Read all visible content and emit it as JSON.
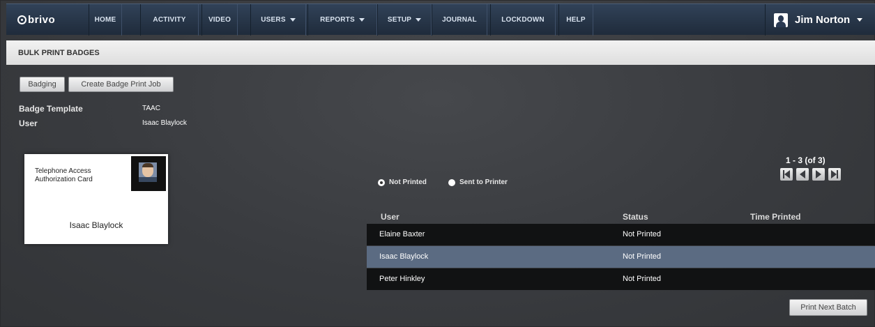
{
  "app": {
    "logo_text": "brivo"
  },
  "nav": {
    "home": "HOME",
    "activity": "ACTIVITY",
    "video": "VIDEO",
    "users": "USERS",
    "reports": "REPORTS",
    "setup": "SETUP",
    "journal": "JOURNAL",
    "lockdown": "LOCKDOWN",
    "help": "HELP",
    "user_name": "Jim Norton"
  },
  "page": {
    "title": "BULK PRINT BADGES"
  },
  "toolbar": {
    "badging_label": "Badging",
    "create_job_label": "Create Badge Print Job"
  },
  "details": {
    "template_label": "Badge Template",
    "template_value": "TAAC",
    "user_label": "User",
    "user_value": "Isaac Blaylock"
  },
  "badge": {
    "title_line1": "Telephone Access",
    "title_line2": "Authorization Card",
    "name": "Isaac Blaylock"
  },
  "filters": {
    "not_printed": "Not Printed",
    "sent_to_printer": "Sent to Printer",
    "selected": "not_printed"
  },
  "pagination": {
    "count_text": "1 - 3 (of 3)"
  },
  "table": {
    "headers": {
      "user": "User",
      "status": "Status",
      "time_printed": "Time Printed"
    },
    "rows": [
      {
        "user": "Elaine Baxter",
        "status": "Not Printed",
        "time_printed": ""
      },
      {
        "user": "Isaac Blaylock",
        "status": "Not Printed",
        "time_printed": ""
      },
      {
        "user": "Peter Hinkley",
        "status": "Not Printed",
        "time_printed": ""
      }
    ]
  },
  "actions": {
    "print_next_batch": "Print Next Batch"
  },
  "colors": {
    "nav_bg": "#263447",
    "row_dark": "#111213",
    "row_selected": "#5b6b82",
    "background": "#3c3e42"
  },
  "icons": {
    "user_avatar": "person-silhouette-icon",
    "first_page": "first-page-icon",
    "prev_page": "prev-page-icon",
    "next_page": "next-page-icon",
    "last_page": "last-page-icon"
  }
}
